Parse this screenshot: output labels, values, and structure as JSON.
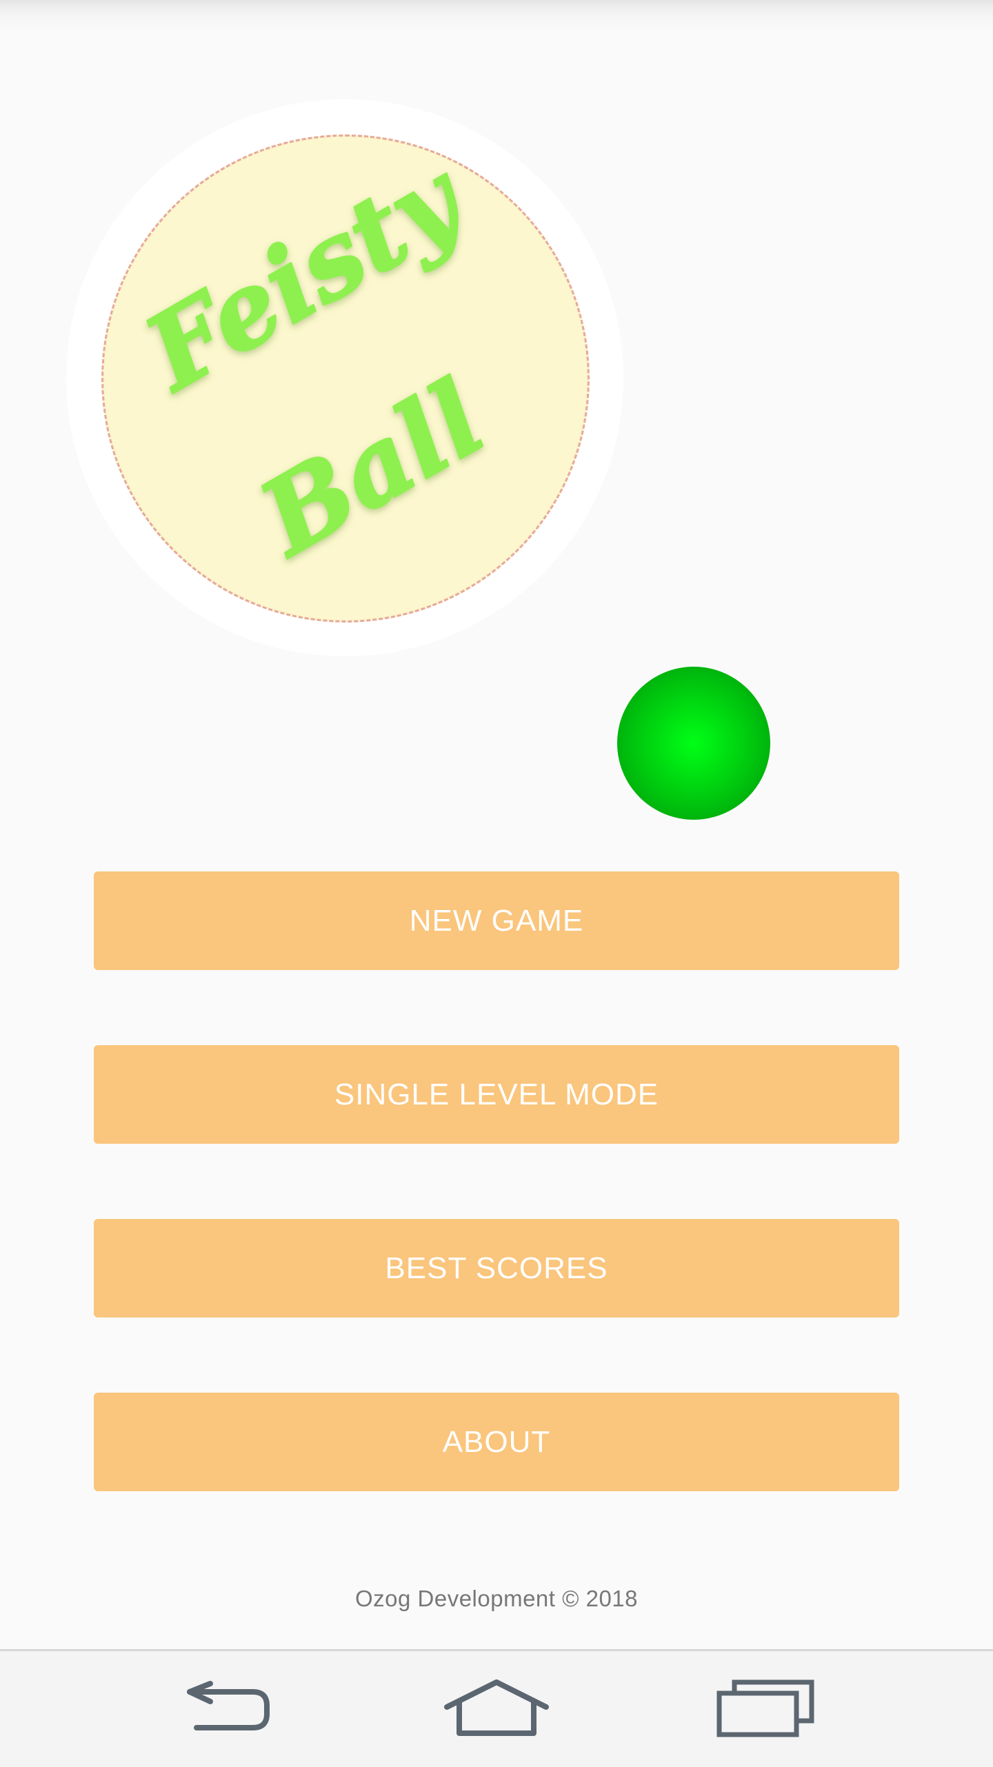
{
  "logo": {
    "line1": "Feisty",
    "line2": "Ball"
  },
  "colors": {
    "background": "#fafafa",
    "button_bg": "#fac57c",
    "button_text": "#ffffff",
    "logo_text": "#8ef04f",
    "logo_circle": "#fdf7cf",
    "ball": "#00e612"
  },
  "menu": {
    "new_game": "NEW GAME",
    "single_level_mode": "SINGLE LEVEL MODE",
    "best_scores": "BEST SCORES",
    "about": "ABOUT"
  },
  "footer": {
    "text": "Ozog Development © 2018"
  },
  "nav": {
    "back_icon": "back-arrow-icon",
    "home_icon": "home-icon",
    "recents_icon": "recent-apps-icon"
  }
}
